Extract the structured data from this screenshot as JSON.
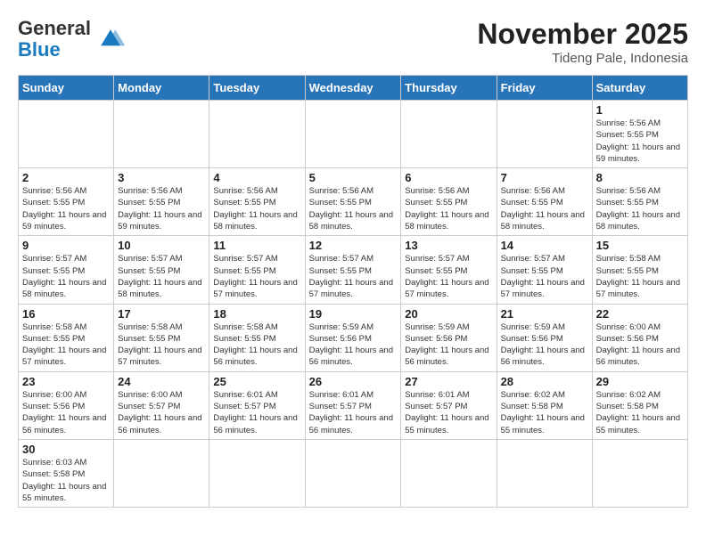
{
  "header": {
    "logo_general": "General",
    "logo_blue": "Blue",
    "month_title": "November 2025",
    "subtitle": "Tideng Pale, Indonesia"
  },
  "calendar": {
    "days_of_week": [
      "Sunday",
      "Monday",
      "Tuesday",
      "Wednesday",
      "Thursday",
      "Friday",
      "Saturday"
    ],
    "weeks": [
      [
        {
          "day": "",
          "content": ""
        },
        {
          "day": "",
          "content": ""
        },
        {
          "day": "",
          "content": ""
        },
        {
          "day": "",
          "content": ""
        },
        {
          "day": "",
          "content": ""
        },
        {
          "day": "",
          "content": ""
        },
        {
          "day": "1",
          "content": "Sunrise: 5:56 AM\nSunset: 5:55 PM\nDaylight: 11 hours and 59 minutes."
        }
      ],
      [
        {
          "day": "2",
          "content": "Sunrise: 5:56 AM\nSunset: 5:55 PM\nDaylight: 11 hours and 59 minutes."
        },
        {
          "day": "3",
          "content": "Sunrise: 5:56 AM\nSunset: 5:55 PM\nDaylight: 11 hours and 59 minutes."
        },
        {
          "day": "4",
          "content": "Sunrise: 5:56 AM\nSunset: 5:55 PM\nDaylight: 11 hours and 58 minutes."
        },
        {
          "day": "5",
          "content": "Sunrise: 5:56 AM\nSunset: 5:55 PM\nDaylight: 11 hours and 58 minutes."
        },
        {
          "day": "6",
          "content": "Sunrise: 5:56 AM\nSunset: 5:55 PM\nDaylight: 11 hours and 58 minutes."
        },
        {
          "day": "7",
          "content": "Sunrise: 5:56 AM\nSunset: 5:55 PM\nDaylight: 11 hours and 58 minutes."
        },
        {
          "day": "8",
          "content": "Sunrise: 5:56 AM\nSunset: 5:55 PM\nDaylight: 11 hours and 58 minutes."
        }
      ],
      [
        {
          "day": "9",
          "content": "Sunrise: 5:57 AM\nSunset: 5:55 PM\nDaylight: 11 hours and 58 minutes."
        },
        {
          "day": "10",
          "content": "Sunrise: 5:57 AM\nSunset: 5:55 PM\nDaylight: 11 hours and 58 minutes."
        },
        {
          "day": "11",
          "content": "Sunrise: 5:57 AM\nSunset: 5:55 PM\nDaylight: 11 hours and 57 minutes."
        },
        {
          "day": "12",
          "content": "Sunrise: 5:57 AM\nSunset: 5:55 PM\nDaylight: 11 hours and 57 minutes."
        },
        {
          "day": "13",
          "content": "Sunrise: 5:57 AM\nSunset: 5:55 PM\nDaylight: 11 hours and 57 minutes."
        },
        {
          "day": "14",
          "content": "Sunrise: 5:57 AM\nSunset: 5:55 PM\nDaylight: 11 hours and 57 minutes."
        },
        {
          "day": "15",
          "content": "Sunrise: 5:58 AM\nSunset: 5:55 PM\nDaylight: 11 hours and 57 minutes."
        }
      ],
      [
        {
          "day": "16",
          "content": "Sunrise: 5:58 AM\nSunset: 5:55 PM\nDaylight: 11 hours and 57 minutes."
        },
        {
          "day": "17",
          "content": "Sunrise: 5:58 AM\nSunset: 5:55 PM\nDaylight: 11 hours and 57 minutes."
        },
        {
          "day": "18",
          "content": "Sunrise: 5:58 AM\nSunset: 5:55 PM\nDaylight: 11 hours and 56 minutes."
        },
        {
          "day": "19",
          "content": "Sunrise: 5:59 AM\nSunset: 5:56 PM\nDaylight: 11 hours and 56 minutes."
        },
        {
          "day": "20",
          "content": "Sunrise: 5:59 AM\nSunset: 5:56 PM\nDaylight: 11 hours and 56 minutes."
        },
        {
          "day": "21",
          "content": "Sunrise: 5:59 AM\nSunset: 5:56 PM\nDaylight: 11 hours and 56 minutes."
        },
        {
          "day": "22",
          "content": "Sunrise: 6:00 AM\nSunset: 5:56 PM\nDaylight: 11 hours and 56 minutes."
        }
      ],
      [
        {
          "day": "23",
          "content": "Sunrise: 6:00 AM\nSunset: 5:56 PM\nDaylight: 11 hours and 56 minutes."
        },
        {
          "day": "24",
          "content": "Sunrise: 6:00 AM\nSunset: 5:57 PM\nDaylight: 11 hours and 56 minutes."
        },
        {
          "day": "25",
          "content": "Sunrise: 6:01 AM\nSunset: 5:57 PM\nDaylight: 11 hours and 56 minutes."
        },
        {
          "day": "26",
          "content": "Sunrise: 6:01 AM\nSunset: 5:57 PM\nDaylight: 11 hours and 56 minutes."
        },
        {
          "day": "27",
          "content": "Sunrise: 6:01 AM\nSunset: 5:57 PM\nDaylight: 11 hours and 55 minutes."
        },
        {
          "day": "28",
          "content": "Sunrise: 6:02 AM\nSunset: 5:58 PM\nDaylight: 11 hours and 55 minutes."
        },
        {
          "day": "29",
          "content": "Sunrise: 6:02 AM\nSunset: 5:58 PM\nDaylight: 11 hours and 55 minutes."
        }
      ],
      [
        {
          "day": "30",
          "content": "Sunrise: 6:03 AM\nSunset: 5:58 PM\nDaylight: 11 hours and 55 minutes."
        },
        {
          "day": "",
          "content": ""
        },
        {
          "day": "",
          "content": ""
        },
        {
          "day": "",
          "content": ""
        },
        {
          "day": "",
          "content": ""
        },
        {
          "day": "",
          "content": ""
        },
        {
          "day": "",
          "content": ""
        }
      ]
    ]
  }
}
